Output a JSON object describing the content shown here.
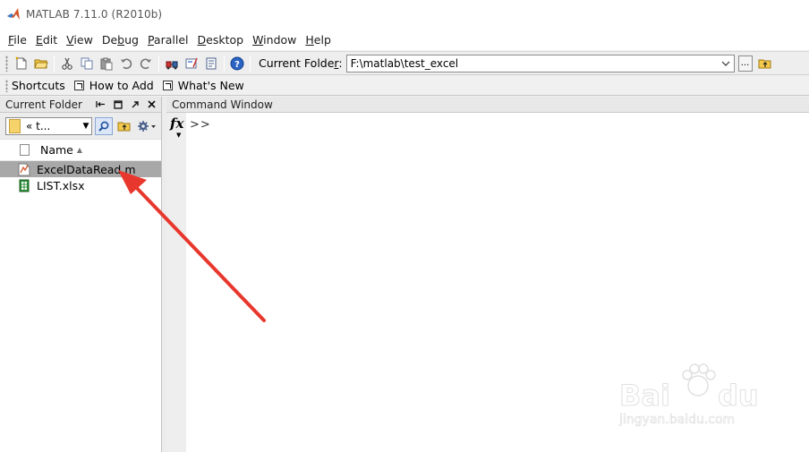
{
  "window": {
    "title": "MATLAB  7.11.0 (R2010b)"
  },
  "menu": {
    "items": [
      {
        "key": "F",
        "rest": "ile"
      },
      {
        "key": "E",
        "rest": "dit"
      },
      {
        "key": "V",
        "rest": "iew"
      },
      {
        "key": "",
        "pre": "De",
        "keymid": "b",
        "rest": "ug"
      },
      {
        "key": "P",
        "rest": "arallel"
      },
      {
        "key": "D",
        "rest": "esktop"
      },
      {
        "key": "W",
        "rest": "indow"
      },
      {
        "key": "H",
        "rest": "elp"
      }
    ]
  },
  "toolbar": {
    "current_folder_label": "Current Folde",
    "current_folder_key": "r",
    "current_folder_suffix": ":",
    "current_folder_value": "F:\\matlab\\test_excel",
    "browse_label": "..."
  },
  "shortcuts": {
    "items": [
      "Shortcuts",
      "How to Add",
      "What's New"
    ]
  },
  "current_folder_panel": {
    "title": "Current Folder",
    "address_text": "«  t...",
    "column_name": "Name",
    "files": [
      {
        "name": "ExcelDataRead.m",
        "type": "m-file",
        "selected": true
      },
      {
        "name": "LIST.xlsx",
        "type": "excel",
        "selected": false
      }
    ]
  },
  "command_window": {
    "title": "Command Window",
    "fx_label": "fx",
    "prompt": ">>"
  },
  "watermark": {
    "url": "jingyan.baidu.com"
  },
  "colors": {
    "annotation_arrow": "#e8372c",
    "selection": "#a8a8a8"
  }
}
